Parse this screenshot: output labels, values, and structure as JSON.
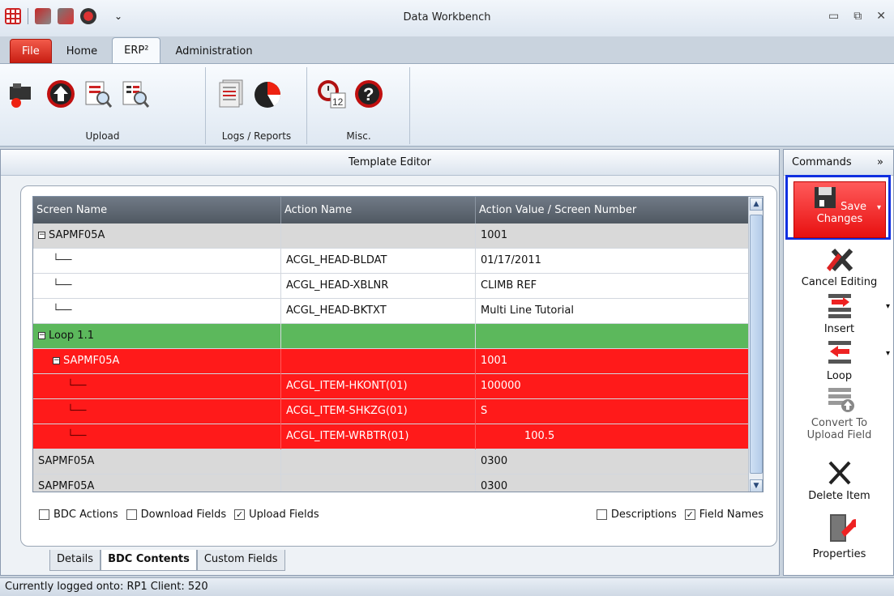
{
  "window": {
    "title": "Data Workbench"
  },
  "ribbon_tabs": [
    {
      "label": "File"
    },
    {
      "label": "Home"
    },
    {
      "label": "ERP²"
    },
    {
      "label": "Administration"
    }
  ],
  "ribbon_groups": {
    "upload": {
      "label": "Upload"
    },
    "logs_reports": {
      "label": "Logs / Reports"
    },
    "misc": {
      "label": "Misc."
    }
  },
  "panel": {
    "title": "Template Editor"
  },
  "grid": {
    "columns": [
      "Screen Name",
      "Action Name",
      "Action Value / Screen Number"
    ],
    "rows": [
      {
        "style": "gray",
        "screen": "SAPMF05A",
        "action": "",
        "value": "1001",
        "expander": "−",
        "level": 0
      },
      {
        "style": "white",
        "screen": "",
        "action": "ACGL_HEAD-BLDAT",
        "value": "01/17/2011",
        "level": 1
      },
      {
        "style": "white",
        "screen": "",
        "action": "ACGL_HEAD-XBLNR",
        "value": "CLIMB REF",
        "level": 1
      },
      {
        "style": "white",
        "screen": "",
        "action": "ACGL_HEAD-BKTXT",
        "value": "Multi Line Tutorial",
        "level": 1
      },
      {
        "style": "green",
        "screen": "Loop 1.1",
        "action": "",
        "value": "",
        "expander": "−",
        "level": 0
      },
      {
        "style": "red",
        "screen": "SAPMF05A",
        "action": "",
        "value": "1001",
        "expander": "−",
        "level": 1
      },
      {
        "style": "red",
        "screen": "",
        "action": "ACGL_ITEM-HKONT(01)",
        "value": "100000",
        "level": 2
      },
      {
        "style": "red",
        "screen": "",
        "action": "ACGL_ITEM-SHKZG(01)",
        "value": "S",
        "level": 2
      },
      {
        "style": "red",
        "screen": "",
        "action": "ACGL_ITEM-WRBTR(01)",
        "value": "100.5",
        "level": 2
      },
      {
        "style": "gray",
        "screen": "SAPMF05A",
        "action": "",
        "value": "0300",
        "level": 0
      },
      {
        "style": "gray",
        "screen": "SAPMF05A",
        "action": "",
        "value": "0300",
        "level": 0
      }
    ]
  },
  "options_left": [
    {
      "label": "BDC Actions",
      "checked": false
    },
    {
      "label": "Download Fields",
      "checked": false
    },
    {
      "label": "Upload Fields",
      "checked": true
    }
  ],
  "options_right": [
    {
      "label": "Descriptions",
      "checked": false
    },
    {
      "label": "Field Names",
      "checked": true
    }
  ],
  "bottom_tabs": [
    {
      "label": "Details",
      "active": false
    },
    {
      "label": "BDC Contents",
      "active": true
    },
    {
      "label": "Custom Fields",
      "active": false
    }
  ],
  "commands": {
    "title": "Commands",
    "more": "»",
    "save": "Save Changes",
    "cancel": "Cancel Editing",
    "insert": "Insert",
    "loop": "Loop",
    "convert": "Convert To Upload Field",
    "delete": "Delete Item",
    "properties": "Properties"
  },
  "status": {
    "text": "Currently logged onto: RP1 Client: 520"
  },
  "colors": {
    "file_tab": "#d9261a",
    "row_red": "#ff1a1a",
    "row_green": "#5cb85c",
    "highlight": "#1030e0"
  }
}
